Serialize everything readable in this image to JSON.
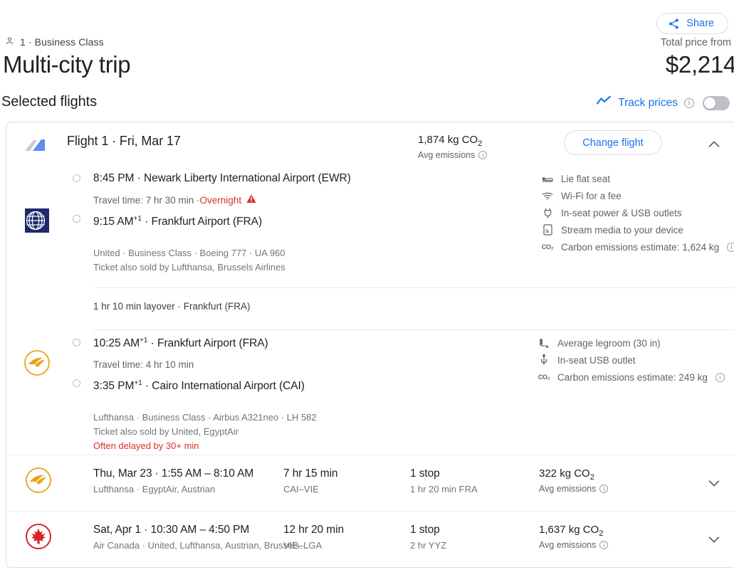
{
  "header": {
    "share_label": "Share",
    "share_icon": "share-icon",
    "passenger_icon": "person-icon",
    "passengers_and_class": "1 · Business Class",
    "title": "Multi-city trip",
    "total_price_label": "Total price from",
    "total_price": "$2,214"
  },
  "selected": {
    "heading": "Selected flights",
    "track_prices_label": "Track prices",
    "track_prices_icon": "trend-line-icon",
    "track_info_icon": "info-icon",
    "track_toggle_state": "off"
  },
  "flight1": {
    "airline_tail_icon": "airplane-tail-icon",
    "title": "Flight 1 · Fri, Mar 17",
    "emissions_value": "1,874 kg CO",
    "emissions_sub": "2",
    "emissions_label": "Avg emissions",
    "change_flight_label": "Change flight",
    "collapse_icon": "chevron-up-icon",
    "legs": [
      {
        "logo": "united-logo",
        "depart": "8:45 PM  ·  Newark Liberty International Airport (EWR)",
        "travel_time": "Travel time: 7 hr 30 min · ",
        "travel_warning": "Overnight",
        "warning_icon": "warning-triangle-icon",
        "arrive_time": "9:15 AM",
        "arrive_plus": "+1",
        "arrive_rest": "  ·  Frankfurt Airport (FRA)",
        "meta1": "United · Business Class · Boeing 777 · UA 960",
        "meta2": "Ticket also sold by Lufthansa, Brussels Airlines",
        "meta3": "",
        "amenities": [
          {
            "icon": "lie-flat-seat-icon",
            "label": "Lie flat seat"
          },
          {
            "icon": "wifi-icon",
            "label": "Wi-Fi for a fee"
          },
          {
            "icon": "power-outlet-icon",
            "label": "In-seat power & USB outlets"
          },
          {
            "icon": "stream-media-icon",
            "label": "Stream media to your device"
          },
          {
            "icon": "co2-icon",
            "label": "Carbon emissions estimate: 1,624 kg",
            "info": "info-icon"
          }
        ]
      },
      {
        "logo": "lufthansa-logo",
        "depart_time": "10:25 AM",
        "depart_plus": "+1",
        "depart_rest": "  ·  Frankfurt Airport (FRA)",
        "travel_time": "Travel time: 4 hr 10 min",
        "arrive_time": "3:35 PM",
        "arrive_plus": "+1",
        "arrive_rest": "  ·  Cairo International Airport (CAI)",
        "meta1": "Lufthansa · Business Class · Airbus A321neo · LH 582",
        "meta2": "Ticket also sold by United, EgyptAir",
        "meta3": "Often delayed by 30+ min",
        "amenities": [
          {
            "icon": "legroom-icon",
            "label": "Average legroom (30 in)"
          },
          {
            "icon": "usb-icon",
            "label": "In-seat USB outlet"
          },
          {
            "icon": "co2-icon",
            "label": "Carbon emissions estimate: 249 kg",
            "info": "info-icon"
          }
        ]
      }
    ],
    "layover": "1 hr 10 min layover · Frankfurt (FRA)"
  },
  "collapsed_flights": [
    {
      "logo": "lufthansa-logo",
      "main": "Thu, Mar 23  ·  1:55 AM – 8:10 AM",
      "sub": "Lufthansa · EgyptAir, Austrian",
      "duration": "7 hr 15 min",
      "route": "CAI–VIE",
      "stops": "1 stop",
      "stops_detail": "1 hr 20 min FRA",
      "emissions_value": "322 kg CO",
      "emissions_sub": "2",
      "emissions_label": "Avg emissions",
      "expand_icon": "chevron-down-icon"
    },
    {
      "logo": "air-canada-logo",
      "main": "Sat, Apr 1  ·  10:30 AM – 4:50 PM",
      "sub": "Air Canada · United, Lufthansa, Austrian, Brussels…",
      "duration": "12 hr 20 min",
      "route": "VIE–LGA",
      "stops": "1 stop",
      "stops_detail": "2 hr YYZ",
      "emissions_value": "1,637 kg CO",
      "emissions_sub": "2",
      "emissions_label": "Avg emissions",
      "expand_icon": "chevron-down-icon"
    }
  ],
  "colors": {
    "accent_blue": "#1a73e8",
    "warning_red": "#d93025",
    "text_primary": "#202124",
    "text_secondary": "#5f6368",
    "border": "#dadce0"
  }
}
